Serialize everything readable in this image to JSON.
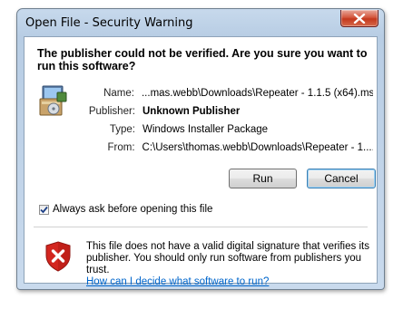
{
  "window": {
    "title": "Open File - Security Warning"
  },
  "headline": "The publisher could not be verified.  Are you sure you want to run this software?",
  "fields": [
    {
      "label": "Name:",
      "value": "...mas.webb\\Downloads\\Repeater - 1.1.5 (x64).msi",
      "bold": false
    },
    {
      "label": "Publisher:",
      "value": "Unknown Publisher",
      "bold": true
    },
    {
      "label": "Type:",
      "value": "Windows Installer Package",
      "bold": false
    },
    {
      "label": "From:",
      "value": "C:\\Users\\thomas.webb\\Downloads\\Repeater - 1....",
      "bold": false
    }
  ],
  "buttons": {
    "run": "Run",
    "cancel": "Cancel"
  },
  "checkbox": {
    "label": "Always ask before opening this file",
    "checked": true
  },
  "warning": {
    "text": "This file does not have a valid digital signature that verifies its publisher.  You should only run software from publishers you trust.",
    "link": "How can I decide what software to run?"
  },
  "colors": {
    "accent": "#3c7fb1",
    "link": "#0066cc",
    "shield": "#d3261f"
  }
}
